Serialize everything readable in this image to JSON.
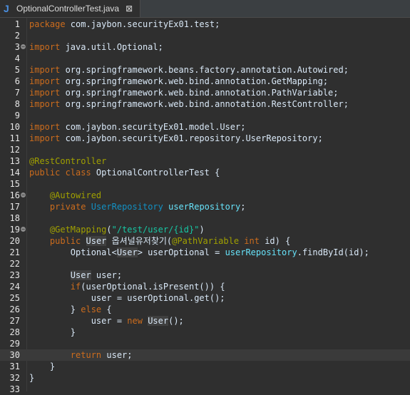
{
  "tab": {
    "title": "OptionalControllerTest.java",
    "close_glyph": "⊠",
    "icon": "java-file-icon"
  },
  "fold_markers": [
    3,
    16,
    19
  ],
  "colors": {
    "keyword": "#cc6c1d",
    "annotation": "#a0a000",
    "field": "#66e1f8",
    "string": "#17c6a3",
    "type": "#1290c3",
    "plain": "#d9e8f7",
    "background": "#2f2f2f"
  },
  "lines": [
    {
      "n": "1",
      "tokens": [
        {
          "t": "package",
          "c": "kw"
        },
        {
          "t": " com.jaybon.securityEx01.test;",
          "c": "pl"
        }
      ]
    },
    {
      "n": "2",
      "tokens": []
    },
    {
      "n": "3",
      "tokens": [
        {
          "t": "import",
          "c": "kw"
        },
        {
          "t": " java.util.Optional;",
          "c": "pl"
        }
      ]
    },
    {
      "n": "4",
      "tokens": []
    },
    {
      "n": "5",
      "tokens": [
        {
          "t": "import",
          "c": "kw"
        },
        {
          "t": " org.springframework.beans.factory.annotation.Autowired;",
          "c": "pl"
        }
      ]
    },
    {
      "n": "6",
      "tokens": [
        {
          "t": "import",
          "c": "kw"
        },
        {
          "t": " org.springframework.web.bind.annotation.GetMapping;",
          "c": "pl"
        }
      ]
    },
    {
      "n": "7",
      "tokens": [
        {
          "t": "import",
          "c": "kw"
        },
        {
          "t": " org.springframework.web.bind.annotation.PathVariable;",
          "c": "pl"
        }
      ]
    },
    {
      "n": "8",
      "tokens": [
        {
          "t": "import",
          "c": "kw"
        },
        {
          "t": " org.springframework.web.bind.annotation.RestController;",
          "c": "pl"
        }
      ]
    },
    {
      "n": "9",
      "tokens": []
    },
    {
      "n": "10",
      "tokens": [
        {
          "t": "import",
          "c": "kw"
        },
        {
          "t": " com.jaybon.securityEx01.model.User;",
          "c": "pl"
        }
      ]
    },
    {
      "n": "11",
      "tokens": [
        {
          "t": "import",
          "c": "kw"
        },
        {
          "t": " com.jaybon.securityEx01.repository.UserRepository;",
          "c": "pl"
        }
      ]
    },
    {
      "n": "12",
      "tokens": []
    },
    {
      "n": "13",
      "tokens": [
        {
          "t": "@RestController",
          "c": "an"
        }
      ]
    },
    {
      "n": "14",
      "tokens": [
        {
          "t": "public class",
          "c": "kw"
        },
        {
          "t": " OptionalControllerTest {",
          "c": "pl"
        }
      ]
    },
    {
      "n": "15",
      "tokens": []
    },
    {
      "n": "16",
      "tokens": [
        {
          "t": "    ",
          "c": "pl"
        },
        {
          "t": "@Autowired",
          "c": "an"
        }
      ]
    },
    {
      "n": "17",
      "tokens": [
        {
          "t": "    ",
          "c": "pl"
        },
        {
          "t": "private",
          "c": "kw"
        },
        {
          "t": " ",
          "c": "pl"
        },
        {
          "t": "UserRepository",
          "c": "ty"
        },
        {
          "t": " ",
          "c": "pl"
        },
        {
          "t": "userRepository",
          "c": "fld"
        },
        {
          "t": ";",
          "c": "pl"
        }
      ]
    },
    {
      "n": "18",
      "tokens": []
    },
    {
      "n": "19",
      "tokens": [
        {
          "t": "    ",
          "c": "pl"
        },
        {
          "t": "@GetMapping",
          "c": "an"
        },
        {
          "t": "(",
          "c": "pl"
        },
        {
          "t": "\"/test/user/{id}\"",
          "c": "str"
        },
        {
          "t": ")",
          "c": "pl"
        }
      ]
    },
    {
      "n": "20",
      "tokens": [
        {
          "t": "    ",
          "c": "pl"
        },
        {
          "t": "public",
          "c": "kw"
        },
        {
          "t": " ",
          "c": "pl"
        },
        {
          "t": "User",
          "c": "hl"
        },
        {
          "t": " 옵셔널유저찾기(",
          "c": "pl"
        },
        {
          "t": "@PathVariable",
          "c": "an"
        },
        {
          "t": " ",
          "c": "pl"
        },
        {
          "t": "int",
          "c": "kw"
        },
        {
          "t": " id) {",
          "c": "pl"
        }
      ]
    },
    {
      "n": "21",
      "tokens": [
        {
          "t": "        Optional<",
          "c": "pl"
        },
        {
          "t": "User",
          "c": "hl"
        },
        {
          "t": "> userOptional = ",
          "c": "pl"
        },
        {
          "t": "userRepository",
          "c": "fld"
        },
        {
          "t": ".findById(id);",
          "c": "pl"
        }
      ]
    },
    {
      "n": "22",
      "tokens": []
    },
    {
      "n": "23",
      "tokens": [
        {
          "t": "        ",
          "c": "pl"
        },
        {
          "t": "User",
          "c": "hl"
        },
        {
          "t": " user;",
          "c": "pl"
        }
      ]
    },
    {
      "n": "24",
      "tokens": [
        {
          "t": "        ",
          "c": "pl"
        },
        {
          "t": "if",
          "c": "kw"
        },
        {
          "t": "(userOptional.isPresent()) {",
          "c": "pl"
        }
      ]
    },
    {
      "n": "25",
      "tokens": [
        {
          "t": "            user = userOptional.get();",
          "c": "pl"
        }
      ]
    },
    {
      "n": "26",
      "tokens": [
        {
          "t": "        } ",
          "c": "pl"
        },
        {
          "t": "else",
          "c": "kw"
        },
        {
          "t": " {",
          "c": "pl"
        }
      ]
    },
    {
      "n": "27",
      "tokens": [
        {
          "t": "            user = ",
          "c": "pl"
        },
        {
          "t": "new",
          "c": "kw"
        },
        {
          "t": " ",
          "c": "pl"
        },
        {
          "t": "User",
          "c": "hl"
        },
        {
          "t": "();",
          "c": "pl"
        }
      ]
    },
    {
      "n": "28",
      "tokens": [
        {
          "t": "        }",
          "c": "pl"
        }
      ]
    },
    {
      "n": "29",
      "tokens": []
    },
    {
      "n": "30",
      "tokens": [
        {
          "t": "        ",
          "c": "pl"
        },
        {
          "t": "return",
          "c": "kw"
        },
        {
          "t": " user;",
          "c": "pl"
        }
      ]
    },
    {
      "n": "31",
      "tokens": [
        {
          "t": "    }",
          "c": "pl"
        }
      ]
    },
    {
      "n": "32",
      "tokens": [
        {
          "t": "}",
          "c": "pl"
        }
      ]
    },
    {
      "n": "33",
      "tokens": []
    }
  ]
}
